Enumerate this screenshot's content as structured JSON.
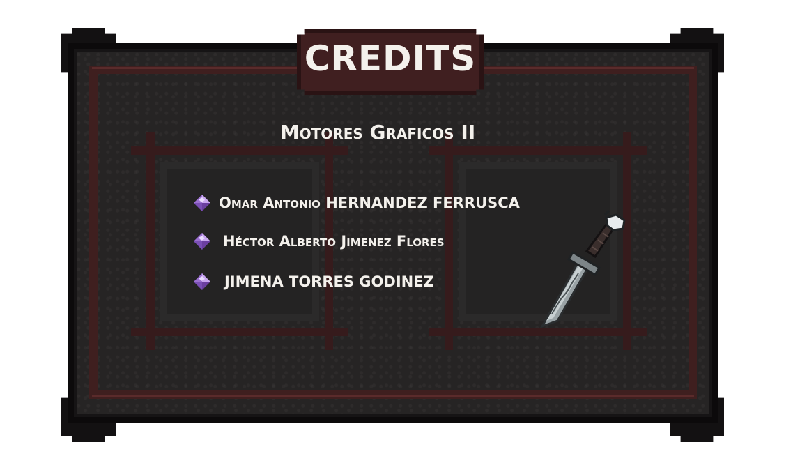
{
  "screen": {
    "title": "CREDITS",
    "subtitle": "Motores Graficos II"
  },
  "credits": {
    "names": [
      "Omar Antonio HERNANDEZ FERRUSCA",
      "Héctor Alberto Jimenez Flores",
      "JIMENA TORRES GODINEZ"
    ]
  },
  "icons": {
    "bullet": "purple-gem-icon",
    "decoration": "sword-icon"
  },
  "colors": {
    "panel": "#262424",
    "frame": "#3f1f1f",
    "text": "#f4f1ec",
    "gem": "#9b6fd0"
  }
}
